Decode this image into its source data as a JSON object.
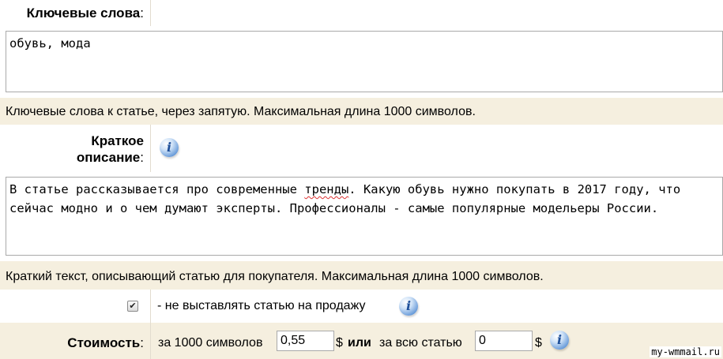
{
  "keywords": {
    "label": "Ключевые слова",
    "colon": ":",
    "value": "обувь, мода",
    "hint": "Ключевые слова к статье, через запятую. Максимальная длина 1000 символов."
  },
  "description": {
    "label_line1": "Краткое",
    "label_line2": "описание",
    "colon": ":",
    "text_part1": "В статье рассказывается про современные ",
    "text_misspelled": "тренды",
    "text_part2": ". Какую обувь нужно покупать в 2017 году, что сейчас модно и о чем думают эксперты. Профессионалы - самые популярные модельеры России.",
    "hint": "Краткий текст, описывающий статью для покупателя. Максимальная длина 1000 символов."
  },
  "not_for_sale": {
    "checked": true,
    "check_glyph": "✔",
    "label": "- не выставлять статью на продажу"
  },
  "price": {
    "label": "Стоимость",
    "colon": ":",
    "per_1000_text": "за 1000 символов",
    "per_1000_value": "0,55",
    "currency": "$",
    "or_text": "или",
    "whole_article_text": "за всю статью",
    "whole_article_value": "0"
  },
  "info_icon_glyph": "i",
  "watermark": "my-wmmail.ru"
}
